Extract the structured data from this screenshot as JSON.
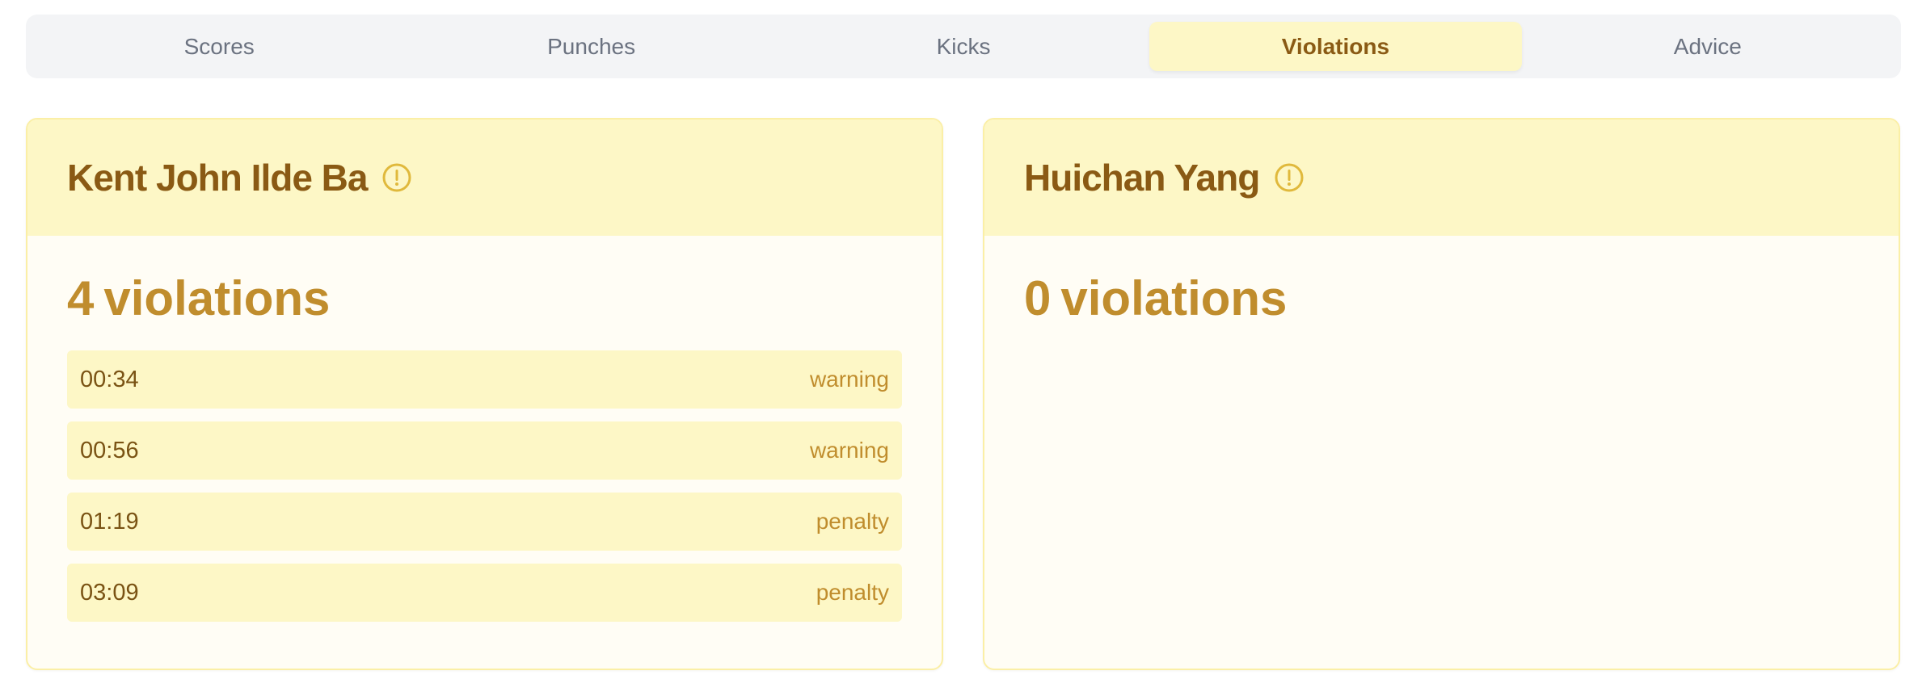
{
  "tabs": [
    {
      "label": "Scores"
    },
    {
      "label": "Punches"
    },
    {
      "label": "Kicks"
    },
    {
      "label": "Violations"
    },
    {
      "label": "Advice"
    }
  ],
  "active_tab": "Violations",
  "fighters": [
    {
      "name": "Kent John Ilde Ba",
      "violation_count": "4",
      "violations_word": "violations",
      "violations": [
        {
          "time": "00:34",
          "type": "warning"
        },
        {
          "time": "00:56",
          "type": "warning"
        },
        {
          "time": "01:19",
          "type": "penalty"
        },
        {
          "time": "03:09",
          "type": "penalty"
        }
      ]
    },
    {
      "name": "Huichan Yang",
      "violation_count": "0",
      "violations_word": "violations",
      "violations": []
    }
  ],
  "icons": {
    "header": "alert-circle-icon"
  },
  "colors": {
    "accent": "#c08d2d",
    "header_bg": "#fdf7c6",
    "title": "#8a5a14"
  }
}
